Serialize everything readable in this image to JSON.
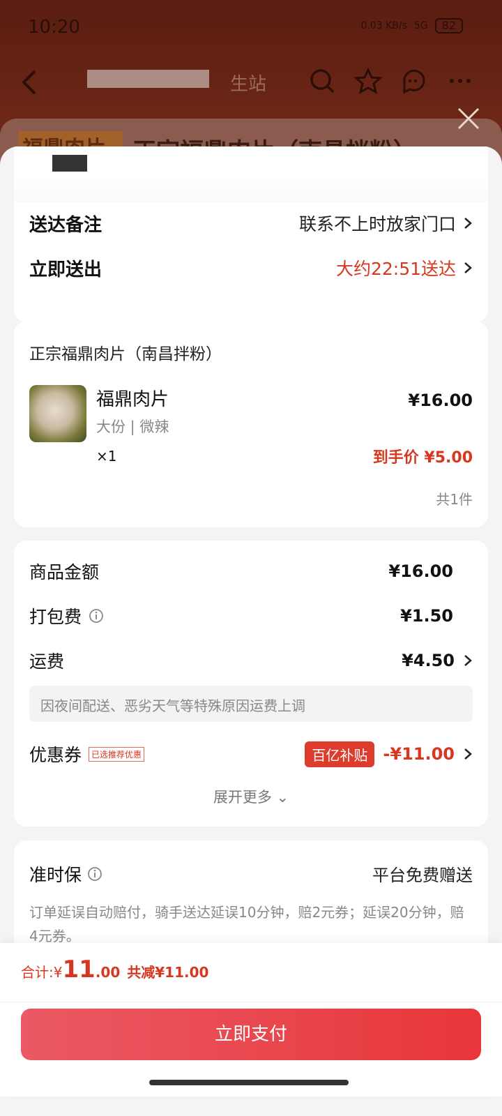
{
  "status_bar": {
    "time": "10:20",
    "net": "0.03 KB/s",
    "signal": "5G",
    "battery": "82"
  },
  "nav": {
    "title": "生站"
  },
  "background_sheet": {
    "title": "正宗福鼎肉片（南昌拌粉）",
    "logo_text": "福鼎肉片"
  },
  "delivery": {
    "note_label": "送达备注",
    "note_value": "联系不上时放家门口",
    "time_label": "立即送出",
    "time_value": "大约22:51送达"
  },
  "order": {
    "shop_name": "正宗福鼎肉片（南昌拌粉）",
    "item": {
      "name": "福鼎肉片",
      "spec": "大份 | 微辣",
      "qty": "×1",
      "price": "¥16.00",
      "final_price": "到手价 ¥5.00"
    },
    "count": "共1件"
  },
  "fees": {
    "goods_label": "商品金额",
    "goods_value": "¥16.00",
    "pack_label": "打包费",
    "pack_value": "¥1.50",
    "ship_label": "运费",
    "ship_value": "¥4.50",
    "ship_note": "因夜间配送、恶劣天气等特殊原因运费上调",
    "coupon_label": "优惠券",
    "coupon_tag": "已选推荐优惠",
    "coupon_pill": "百亿补贴",
    "coupon_value": "-¥11.00",
    "expand": "展开更多 ⌄"
  },
  "insurance": {
    "title": "准时保",
    "right": "平台免费赠送",
    "desc": "订单延误自动赔付，骑手送达延误10分钟，赔2元券；延误20分钟，赔4元券。"
  },
  "bottom": {
    "total_label": "合计: ",
    "currency": "¥",
    "total_int": "11",
    "total_dec": ".00",
    "reduce": "共减¥11.00",
    "pay": "立即支付"
  },
  "colors": {
    "accent": "#d8371f",
    "pay_button": "#e8363a"
  }
}
